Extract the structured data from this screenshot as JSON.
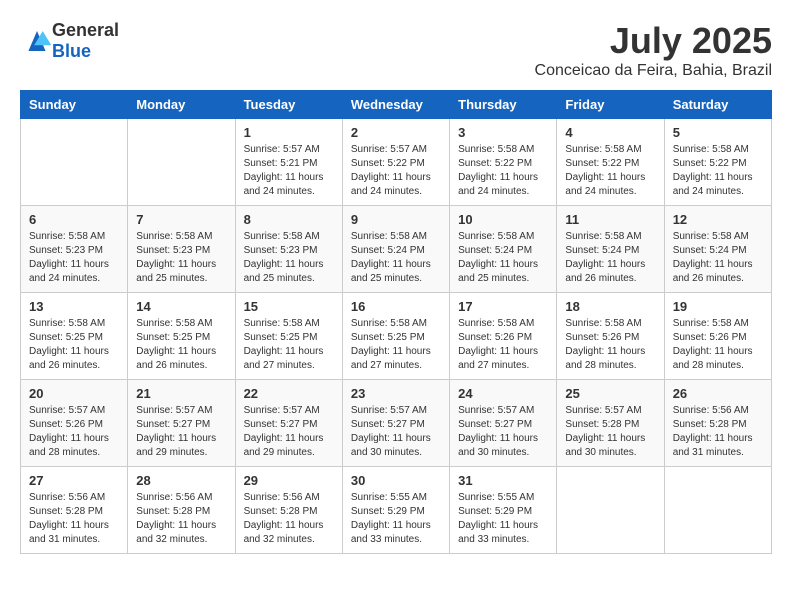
{
  "logo": {
    "general": "General",
    "blue": "Blue"
  },
  "title": "July 2025",
  "location": "Conceicao da Feira, Bahia, Brazil",
  "headers": [
    "Sunday",
    "Monday",
    "Tuesday",
    "Wednesday",
    "Thursday",
    "Friday",
    "Saturday"
  ],
  "weeks": [
    [
      {
        "day": "",
        "info": ""
      },
      {
        "day": "",
        "info": ""
      },
      {
        "day": "1",
        "info": "Sunrise: 5:57 AM\nSunset: 5:21 PM\nDaylight: 11 hours and 24 minutes."
      },
      {
        "day": "2",
        "info": "Sunrise: 5:57 AM\nSunset: 5:22 PM\nDaylight: 11 hours and 24 minutes."
      },
      {
        "day": "3",
        "info": "Sunrise: 5:58 AM\nSunset: 5:22 PM\nDaylight: 11 hours and 24 minutes."
      },
      {
        "day": "4",
        "info": "Sunrise: 5:58 AM\nSunset: 5:22 PM\nDaylight: 11 hours and 24 minutes."
      },
      {
        "day": "5",
        "info": "Sunrise: 5:58 AM\nSunset: 5:22 PM\nDaylight: 11 hours and 24 minutes."
      }
    ],
    [
      {
        "day": "6",
        "info": "Sunrise: 5:58 AM\nSunset: 5:23 PM\nDaylight: 11 hours and 24 minutes."
      },
      {
        "day": "7",
        "info": "Sunrise: 5:58 AM\nSunset: 5:23 PM\nDaylight: 11 hours and 25 minutes."
      },
      {
        "day": "8",
        "info": "Sunrise: 5:58 AM\nSunset: 5:23 PM\nDaylight: 11 hours and 25 minutes."
      },
      {
        "day": "9",
        "info": "Sunrise: 5:58 AM\nSunset: 5:24 PM\nDaylight: 11 hours and 25 minutes."
      },
      {
        "day": "10",
        "info": "Sunrise: 5:58 AM\nSunset: 5:24 PM\nDaylight: 11 hours and 25 minutes."
      },
      {
        "day": "11",
        "info": "Sunrise: 5:58 AM\nSunset: 5:24 PM\nDaylight: 11 hours and 26 minutes."
      },
      {
        "day": "12",
        "info": "Sunrise: 5:58 AM\nSunset: 5:24 PM\nDaylight: 11 hours and 26 minutes."
      }
    ],
    [
      {
        "day": "13",
        "info": "Sunrise: 5:58 AM\nSunset: 5:25 PM\nDaylight: 11 hours and 26 minutes."
      },
      {
        "day": "14",
        "info": "Sunrise: 5:58 AM\nSunset: 5:25 PM\nDaylight: 11 hours and 26 minutes."
      },
      {
        "day": "15",
        "info": "Sunrise: 5:58 AM\nSunset: 5:25 PM\nDaylight: 11 hours and 27 minutes."
      },
      {
        "day": "16",
        "info": "Sunrise: 5:58 AM\nSunset: 5:25 PM\nDaylight: 11 hours and 27 minutes."
      },
      {
        "day": "17",
        "info": "Sunrise: 5:58 AM\nSunset: 5:26 PM\nDaylight: 11 hours and 27 minutes."
      },
      {
        "day": "18",
        "info": "Sunrise: 5:58 AM\nSunset: 5:26 PM\nDaylight: 11 hours and 28 minutes."
      },
      {
        "day": "19",
        "info": "Sunrise: 5:58 AM\nSunset: 5:26 PM\nDaylight: 11 hours and 28 minutes."
      }
    ],
    [
      {
        "day": "20",
        "info": "Sunrise: 5:57 AM\nSunset: 5:26 PM\nDaylight: 11 hours and 28 minutes."
      },
      {
        "day": "21",
        "info": "Sunrise: 5:57 AM\nSunset: 5:27 PM\nDaylight: 11 hours and 29 minutes."
      },
      {
        "day": "22",
        "info": "Sunrise: 5:57 AM\nSunset: 5:27 PM\nDaylight: 11 hours and 29 minutes."
      },
      {
        "day": "23",
        "info": "Sunrise: 5:57 AM\nSunset: 5:27 PM\nDaylight: 11 hours and 30 minutes."
      },
      {
        "day": "24",
        "info": "Sunrise: 5:57 AM\nSunset: 5:27 PM\nDaylight: 11 hours and 30 minutes."
      },
      {
        "day": "25",
        "info": "Sunrise: 5:57 AM\nSunset: 5:28 PM\nDaylight: 11 hours and 30 minutes."
      },
      {
        "day": "26",
        "info": "Sunrise: 5:56 AM\nSunset: 5:28 PM\nDaylight: 11 hours and 31 minutes."
      }
    ],
    [
      {
        "day": "27",
        "info": "Sunrise: 5:56 AM\nSunset: 5:28 PM\nDaylight: 11 hours and 31 minutes."
      },
      {
        "day": "28",
        "info": "Sunrise: 5:56 AM\nSunset: 5:28 PM\nDaylight: 11 hours and 32 minutes."
      },
      {
        "day": "29",
        "info": "Sunrise: 5:56 AM\nSunset: 5:28 PM\nDaylight: 11 hours and 32 minutes."
      },
      {
        "day": "30",
        "info": "Sunrise: 5:55 AM\nSunset: 5:29 PM\nDaylight: 11 hours and 33 minutes."
      },
      {
        "day": "31",
        "info": "Sunrise: 5:55 AM\nSunset: 5:29 PM\nDaylight: 11 hours and 33 minutes."
      },
      {
        "day": "",
        "info": ""
      },
      {
        "day": "",
        "info": ""
      }
    ]
  ]
}
